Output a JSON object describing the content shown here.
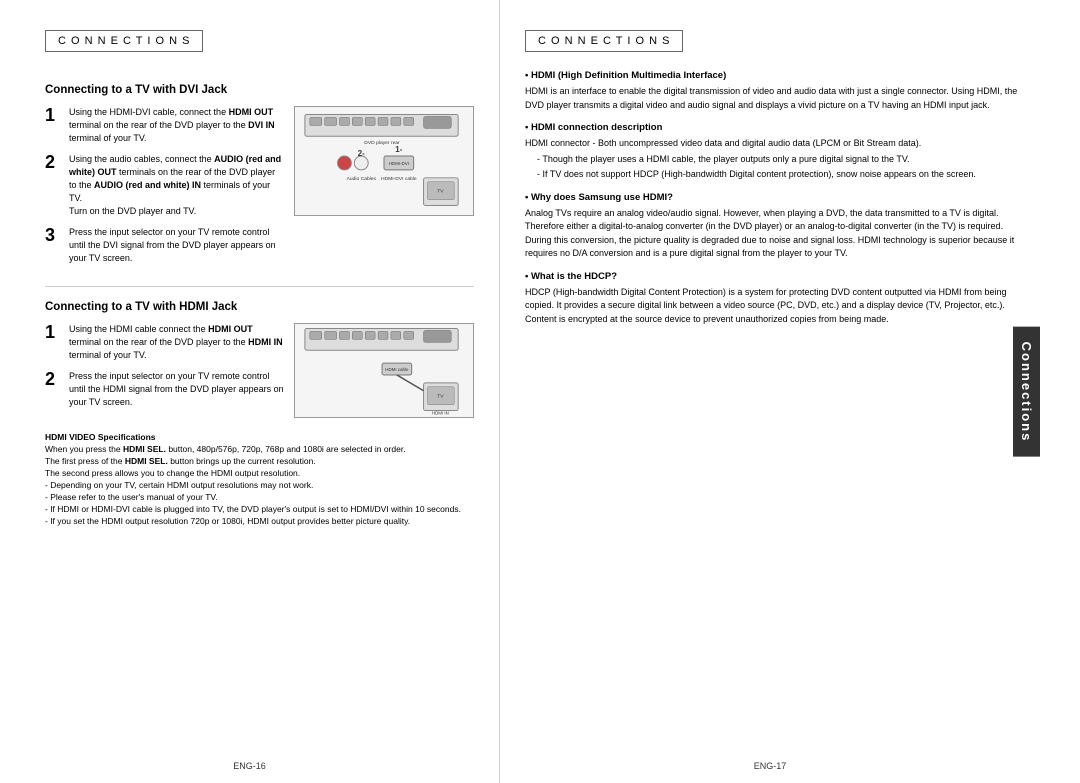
{
  "left": {
    "header": "C O N N E C T I O N S",
    "section1_title": "Connecting to a TV with DVI Jack",
    "step1_text": "Using the HDMI-DVI cable, connect the **HDMI OUT** terminal on the rear of the DVD player to the **DVI IN** terminal of your TV.",
    "step2_text": "Using the audio cables, connect the **AUDIO (red and white) OUT** terminals on the rear of the DVD player to the **AUDIO (red and white) IN** terminals of your TV. Turn on the DVD player and TV.",
    "step3_text": "Press the input selector on your TV remote control until the DVI signal from the DVD player appears on your TV screen.",
    "section2_title": "Connecting to a TV with HDMI Jack",
    "hdmi_step1_text": "Using the HDMI cable connect the **HDMI OUT** terminal on the rear of the DVD player to the **HDMI IN** terminal of your TV.",
    "hdmi_step2_text": "Press the input selector on your TV remote control until the HDMI signal from the DVD player appears on your TV screen.",
    "footer_title": "HDMI VIDEO Specifications",
    "footer_lines": [
      "When you press the **HDMI SEL.** button, 480p/576p, 720p, 768p and 1080i are selected in order.",
      "The first press of the **HDMI SEL.** button brings up the current resolution.",
      "The second press allows you to change the HDMI output resolution.",
      "- Depending on your TV, certain HDMI output resolutions may not work.",
      "- Please refer to the user's manual of your TV.",
      "- If HDMI or HDMI-DVI cable is plugged into TV, the DVD player's output is set to HDMI/DVI within 10 seconds.",
      "- If you set the HDMI output resolution 720p or 1080i, HDMI output provides better picture quality."
    ],
    "page_num": "ENG-16"
  },
  "right": {
    "header": "C O N N E C T I O N S",
    "bullet1_title": "• HDMI (High Definition Multimedia Interface)",
    "bullet1_body": "HDMI is an interface to enable the digital transmission of video and audio data with just a single connector. Using HDMI, the DVD player transmits a digital video and audio signal and displays a vivid picture on a TV having an HDMI input jack.",
    "bullet2_title": "• HDMI connection description",
    "bullet2_body": "HDMI connector - Both uncompressed video data and digital audio data (LPCM or Bit Stream data).",
    "bullet2_sub1": "- Though the player uses a HDMI cable, the player outputs only a pure digital signal to the TV.",
    "bullet2_sub2": "- If TV does not support HDCP (High-bandwidth Digital content protection), snow noise appears on the screen.",
    "bullet3_title": "• Why does Samsung use HDMI?",
    "bullet3_body": "Analog TVs require an analog video/audio signal. However, when playing a DVD, the data transmitted to a TV is digital. Therefore either a digital-to-analog converter (in the DVD player) or an analog-to-digital converter (in the TV) is required. During this conversion, the picture quality is degraded due to noise and signal loss. HDMI technology is superior because it requires no D/A conversion and is a pure digital signal from the player to your TV.",
    "bullet4_title": "• What is the HDCP?",
    "bullet4_body": "HDCP (High-bandwidth Digital Content Protection) is a system for protecting DVD content outputted via HDMI from being copied. It provides a secure digital link between a video source (PC, DVD, etc.) and a display device (TV, Projector, etc.). Content is encrypted at the source device to prevent unauthorized copies from being made.",
    "side_tab": "Connections",
    "page_num": "ENG-17"
  }
}
